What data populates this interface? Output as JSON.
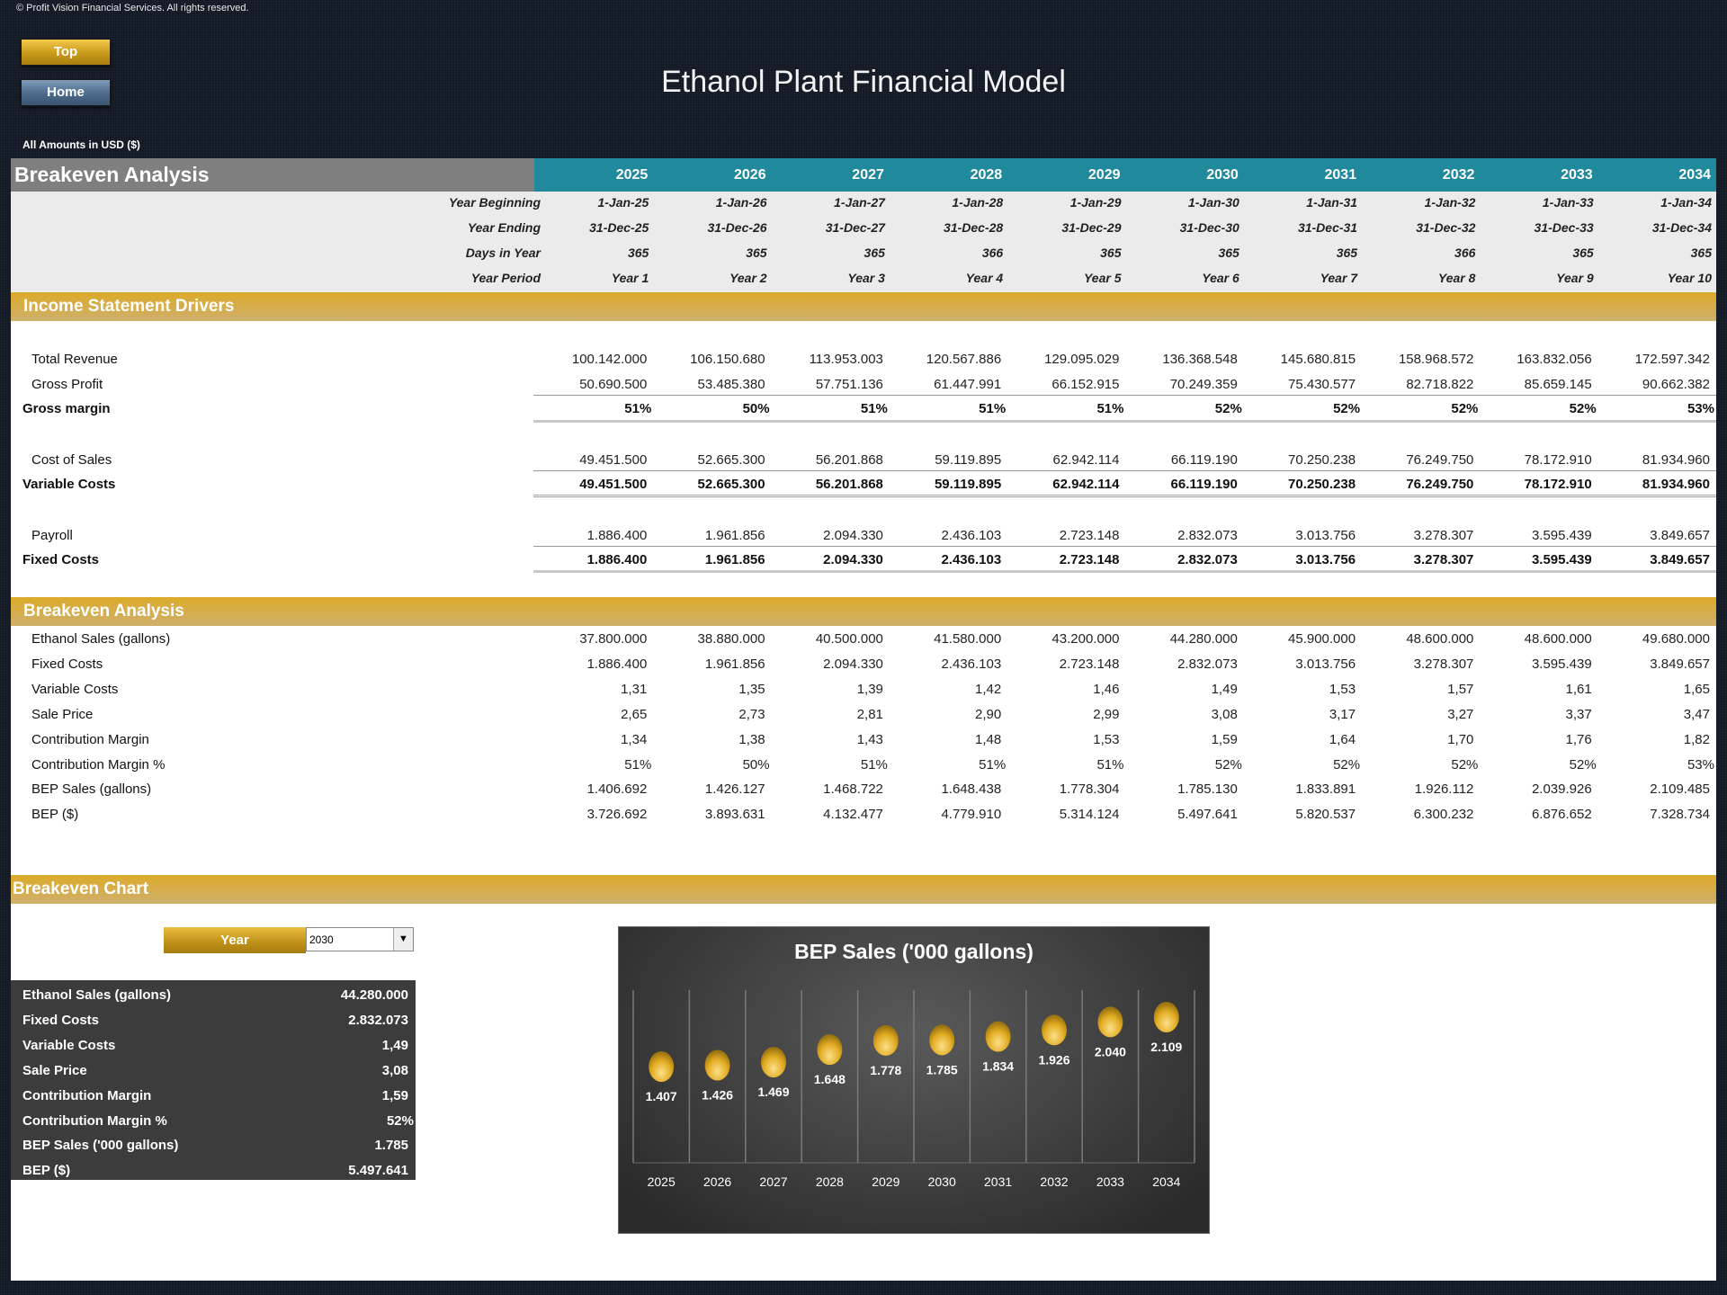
{
  "copyright": "© Profit Vision Financial Services. All rights reserved.",
  "nav": {
    "top_label": "Top",
    "home_label": "Home"
  },
  "title": "Ethanol Plant Financial Model",
  "amounts_note": "All Amounts in  USD ($)",
  "header": {
    "section_title": "Breakeven Analysis",
    "years": [
      "2025",
      "2026",
      "2027",
      "2028",
      "2029",
      "2030",
      "2031",
      "2032",
      "2033",
      "2034"
    ]
  },
  "meta_rows": [
    {
      "label": "Year Beginning",
      "values": [
        "1-Jan-25",
        "1-Jan-26",
        "1-Jan-27",
        "1-Jan-28",
        "1-Jan-29",
        "1-Jan-30",
        "1-Jan-31",
        "1-Jan-32",
        "1-Jan-33",
        "1-Jan-34"
      ]
    },
    {
      "label": "Year Ending",
      "values": [
        "31-Dec-25",
        "31-Dec-26",
        "31-Dec-27",
        "31-Dec-28",
        "31-Dec-29",
        "31-Dec-30",
        "31-Dec-31",
        "31-Dec-32",
        "31-Dec-33",
        "31-Dec-34"
      ]
    },
    {
      "label": "Days in Year",
      "values": [
        "365",
        "365",
        "365",
        "366",
        "365",
        "365",
        "365",
        "366",
        "365",
        "365"
      ]
    },
    {
      "label": "Year Period",
      "values": [
        "Year 1",
        "Year 2",
        "Year 3",
        "Year 4",
        "Year 5",
        "Year 6",
        "Year 7",
        "Year 8",
        "Year 9",
        "Year 10"
      ]
    }
  ],
  "income_section": {
    "title": "Income Statement Drivers",
    "rows": [
      {
        "label": "Total Revenue",
        "bold": false,
        "values": [
          "100.142.000",
          "106.150.680",
          "113.953.003",
          "120.567.886",
          "129.095.029",
          "136.368.548",
          "145.680.815",
          "158.968.572",
          "163.832.056",
          "172.597.342"
        ]
      },
      {
        "label": "Gross Profit",
        "bold": false,
        "values": [
          "50.690.500",
          "53.485.380",
          "57.751.136",
          "61.447.991",
          "66.152.915",
          "70.249.359",
          "75.430.577",
          "82.718.822",
          "85.659.145",
          "90.662.382"
        ]
      },
      {
        "label": "Gross margin",
        "bold": true,
        "values": [
          "51%",
          "50%",
          "51%",
          "51%",
          "51%",
          "52%",
          "52%",
          "52%",
          "52%",
          "53%"
        ]
      },
      {
        "label": "Cost of Sales",
        "bold": false,
        "values": [
          "49.451.500",
          "52.665.300",
          "56.201.868",
          "59.119.895",
          "62.942.114",
          "66.119.190",
          "70.250.238",
          "76.249.750",
          "78.172.910",
          "81.934.960"
        ]
      },
      {
        "label": "Variable Costs",
        "bold": true,
        "values": [
          "49.451.500",
          "52.665.300",
          "56.201.868",
          "59.119.895",
          "62.942.114",
          "66.119.190",
          "70.250.238",
          "76.249.750",
          "78.172.910",
          "81.934.960"
        ]
      },
      {
        "label": "Payroll",
        "bold": false,
        "values": [
          "1.886.400",
          "1.961.856",
          "2.094.330",
          "2.436.103",
          "2.723.148",
          "2.832.073",
          "3.013.756",
          "3.278.307",
          "3.595.439",
          "3.849.657"
        ]
      },
      {
        "label": "Fixed Costs",
        "bold": true,
        "values": [
          "1.886.400",
          "1.961.856",
          "2.094.330",
          "2.436.103",
          "2.723.148",
          "2.832.073",
          "3.013.756",
          "3.278.307",
          "3.595.439",
          "3.849.657"
        ]
      }
    ]
  },
  "breakeven_section": {
    "title": "Breakeven Analysis",
    "rows": [
      {
        "label": "Ethanol Sales (gallons)",
        "values": [
          "37.800.000",
          "38.880.000",
          "40.500.000",
          "41.580.000",
          "43.200.000",
          "44.280.000",
          "45.900.000",
          "48.600.000",
          "48.600.000",
          "49.680.000"
        ]
      },
      {
        "label": "Fixed Costs",
        "values": [
          "1.886.400",
          "1.961.856",
          "2.094.330",
          "2.436.103",
          "2.723.148",
          "2.832.073",
          "3.013.756",
          "3.278.307",
          "3.595.439",
          "3.849.657"
        ]
      },
      {
        "label": "Variable Costs",
        "values": [
          "1,31",
          "1,35",
          "1,39",
          "1,42",
          "1,46",
          "1,49",
          "1,53",
          "1,57",
          "1,61",
          "1,65"
        ]
      },
      {
        "label": "Sale Price",
        "values": [
          "2,65",
          "2,73",
          "2,81",
          "2,90",
          "2,99",
          "3,08",
          "3,17",
          "3,27",
          "3,37",
          "3,47"
        ]
      },
      {
        "label": "Contribution Margin",
        "values": [
          "1,34",
          "1,38",
          "1,43",
          "1,48",
          "1,53",
          "1,59",
          "1,64",
          "1,70",
          "1,76",
          "1,82"
        ]
      },
      {
        "label": "Contribution Margin %",
        "values": [
          "51%",
          "50%",
          "51%",
          "51%",
          "51%",
          "52%",
          "52%",
          "52%",
          "52%",
          "53%"
        ]
      },
      {
        "label": "BEP Sales (gallons)",
        "values": [
          "1.406.692",
          "1.426.127",
          "1.468.722",
          "1.648.438",
          "1.778.304",
          "1.785.130",
          "1.833.891",
          "1.926.112",
          "2.039.926",
          "2.109.485"
        ]
      },
      {
        "label": "BEP ($)",
        "values": [
          "3.726.692",
          "3.893.631",
          "4.132.477",
          "4.779.910",
          "5.314.124",
          "5.497.641",
          "5.820.537",
          "6.300.232",
          "6.876.652",
          "7.328.734"
        ]
      }
    ]
  },
  "chart_section": {
    "title": "Breakeven Chart",
    "year_button_label": "Year",
    "selected_year": "2030",
    "dropdown_icon": "triangle-down",
    "summary": [
      {
        "label": "Ethanol Sales (gallons)",
        "value": "44.280.000"
      },
      {
        "label": "Fixed Costs",
        "value": "2.832.073"
      },
      {
        "label": "Variable Costs",
        "value": "1,49"
      },
      {
        "label": "Sale Price",
        "value": "3,08"
      },
      {
        "label": "Contribution Margin",
        "value": "1,59"
      },
      {
        "label": "Contribution Margin %",
        "value": "52%"
      },
      {
        "label": "BEP Sales ('000 gallons)",
        "value": "1.785"
      },
      {
        "label": "BEP ($)",
        "value": "5.497.641"
      }
    ]
  },
  "chart_data": {
    "type": "scatter",
    "title": "BEP Sales ('000 gallons)",
    "categories": [
      "2025",
      "2026",
      "2027",
      "2028",
      "2029",
      "2030",
      "2031",
      "2032",
      "2033",
      "2034"
    ],
    "values": [
      1407,
      1426,
      1469,
      1648,
      1778,
      1785,
      1834,
      1926,
      2040,
      2109
    ],
    "data_labels": [
      "1.407",
      "1.426",
      "1.469",
      "1.648",
      "1.778",
      "1.785",
      "1.834",
      "1.926",
      "2.040",
      "2.109"
    ],
    "xlabel": "",
    "ylabel": "",
    "ylim": [
      0,
      2400
    ],
    "grid": "vertical",
    "legend": "none",
    "marker_color": "#e8b526"
  }
}
